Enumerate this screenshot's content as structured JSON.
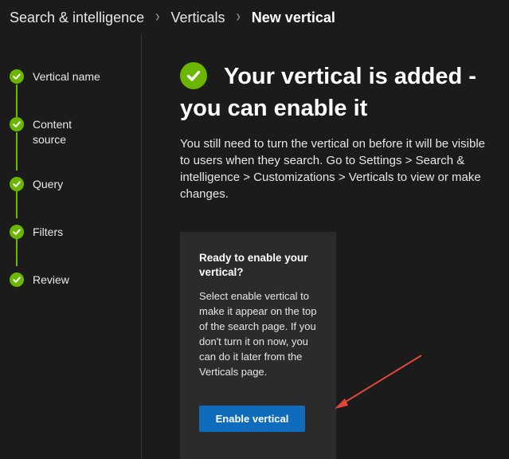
{
  "breadcrumb": {
    "items": [
      "Search & intelligence",
      "Verticals"
    ],
    "current": "New vertical"
  },
  "stepper": {
    "steps": [
      {
        "label": "Vertical name",
        "status": "completed"
      },
      {
        "label": "Content source",
        "status": "completed"
      },
      {
        "label": "Query",
        "status": "completed"
      },
      {
        "label": "Filters",
        "status": "completed"
      },
      {
        "label": "Review",
        "status": "completed"
      }
    ]
  },
  "main": {
    "title": "Your vertical is added - you can enable it",
    "description": "You still need to turn the vertical on before it will be visible to users when they search. Go to Settings > Search & intelligence > Customizations > Verticals to view or make changes.",
    "card": {
      "title": "Ready to enable your vertical?",
      "body": "Select enable vertical to make it appear on the top of the search page. If you don't turn it on now, you can do it later from the Verticals page.",
      "button_label": "Enable vertical"
    }
  },
  "icons": {
    "step_complete": "checkmark-circle-icon",
    "title_complete": "checkmark-circle-icon",
    "separator": "chevron-right-icon"
  },
  "colors": {
    "background": "#1b1b1b",
    "success_green": "#6bb700",
    "card_background": "#2b2b2b",
    "primary_button": "#0f6cbd",
    "annotation_arrow": "#e0473a"
  }
}
